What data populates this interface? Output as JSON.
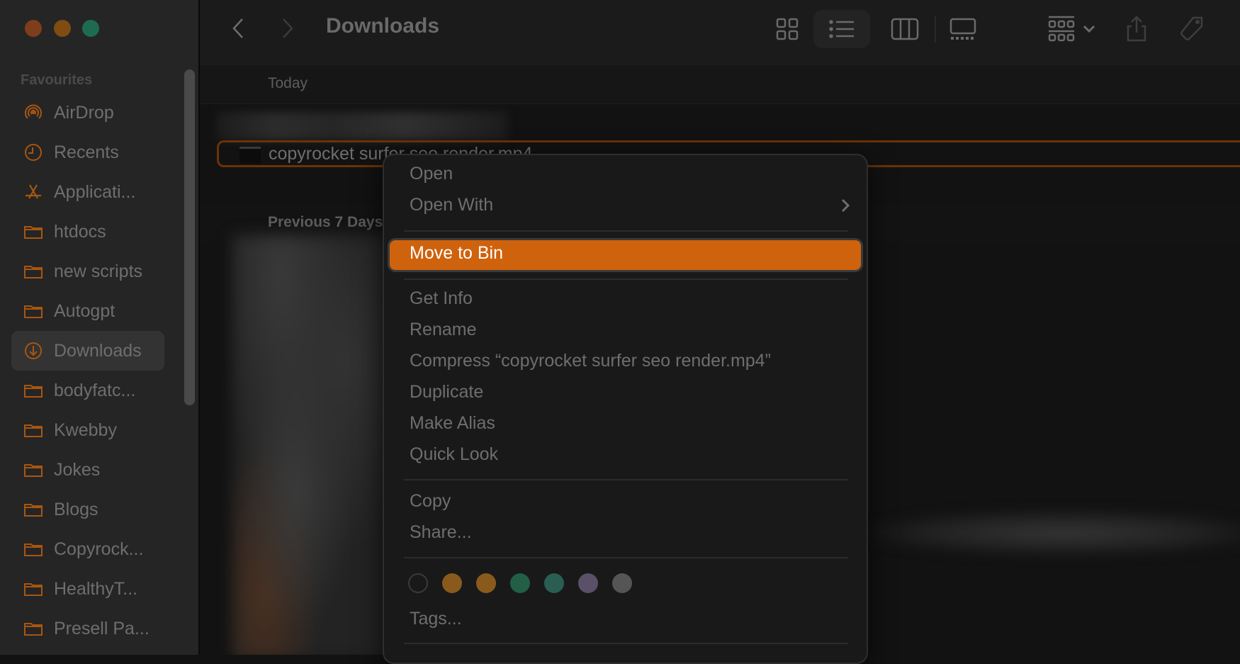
{
  "window": {
    "title": "Downloads",
    "traffic_lights": [
      "close",
      "minimize",
      "zoom"
    ]
  },
  "sidebar": {
    "section_title": "Favourites",
    "items": [
      {
        "label": "AirDrop",
        "icon": "airdrop-icon",
        "active": false
      },
      {
        "label": "Recents",
        "icon": "clock-icon",
        "active": false
      },
      {
        "label": "Applicati...",
        "icon": "applications-icon",
        "active": false
      },
      {
        "label": "htdocs",
        "icon": "folder-icon",
        "active": false
      },
      {
        "label": "new scripts",
        "icon": "folder-icon",
        "active": false
      },
      {
        "label": "Autogpt",
        "icon": "folder-icon",
        "active": false
      },
      {
        "label": "Downloads",
        "icon": "download-icon",
        "active": true
      },
      {
        "label": "bodyfatc...",
        "icon": "folder-icon",
        "active": false
      },
      {
        "label": "Kwebby",
        "icon": "folder-icon",
        "active": false
      },
      {
        "label": "Jokes",
        "icon": "folder-icon",
        "active": false
      },
      {
        "label": "Blogs",
        "icon": "folder-icon",
        "active": false
      },
      {
        "label": "Copyrock...",
        "icon": "folder-icon",
        "active": false
      },
      {
        "label": "HealthyT...",
        "icon": "folder-icon",
        "active": false
      },
      {
        "label": "Presell Pa...",
        "icon": "folder-icon",
        "active": false
      }
    ]
  },
  "toolbar": {
    "title": "Downloads",
    "view_modes": [
      "icon-view",
      "list-view",
      "column-view",
      "gallery-view"
    ],
    "selected_view": "list-view",
    "group_button": "group-by",
    "share": "share",
    "tags": "tags"
  },
  "content": {
    "groups": [
      {
        "label": "Today"
      },
      {
        "label": "Previous 7 Days"
      }
    ],
    "selected_file": "copyrocket surfer seo render.mp4"
  },
  "context_menu": {
    "items": [
      {
        "label": "Open"
      },
      {
        "label": "Open With",
        "submenu": true
      },
      {
        "label": "Move to Bin",
        "highlighted": true
      },
      {
        "label": "Get Info"
      },
      {
        "label": "Rename"
      },
      {
        "label": "Compress “copyrocket surfer seo render.mp4”"
      },
      {
        "label": "Duplicate"
      },
      {
        "label": "Make Alias"
      },
      {
        "label": "Quick Look"
      },
      {
        "label": "Copy"
      },
      {
        "label": "Share..."
      },
      {
        "label": "Tags..."
      }
    ],
    "tag_colors": [
      "none",
      "#8a5a1c",
      "#8a5a1c",
      "#235e47",
      "#2a5e52",
      "#5a5068",
      "#555555"
    ]
  },
  "colors": {
    "accent": "#cf620c",
    "sidebar_icon": "#a8560f",
    "selection_outline": "#6b3208"
  }
}
